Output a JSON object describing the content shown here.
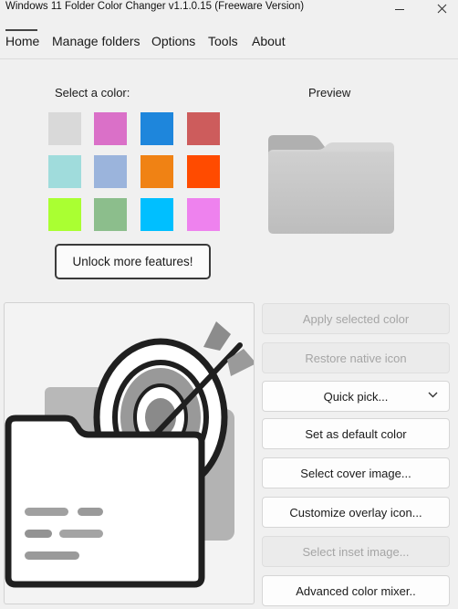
{
  "window": {
    "title": "Windows 11 Folder Color Changer v1.1.0.15 (Freeware Version)",
    "controls": [
      "minimize-icon",
      "close-icon"
    ]
  },
  "menu": {
    "items": [
      {
        "label": "Home",
        "active": true
      },
      {
        "label": "Manage folders"
      },
      {
        "label": "Options"
      },
      {
        "label": "Tools"
      },
      {
        "label": "About"
      }
    ]
  },
  "color_picker": {
    "label": "Select a color:",
    "colors": [
      "#d9d9d9",
      "#da70c8",
      "#1e86dc",
      "#cd5c5c",
      "#a0dcdc",
      "#9bb4dc",
      "#f08214",
      "#ff4b00",
      "#aaff32",
      "#8cbe8c",
      "#00bfff",
      "#ee82ee"
    ],
    "unlock_label": "Unlock more features!"
  },
  "preview": {
    "label": "Preview",
    "folder_color": "#c8c8c8"
  },
  "actions": [
    {
      "label": "Apply selected color",
      "enabled": false
    },
    {
      "label": "Restore native icon",
      "enabled": false
    },
    {
      "label": "Quick pick...",
      "enabled": true,
      "dropdown": true
    },
    {
      "label": "Set as default color",
      "enabled": true
    },
    {
      "label": "Select cover image...",
      "enabled": true
    },
    {
      "label": "Customize overlay icon...",
      "enabled": true
    },
    {
      "label": "Select inset image...",
      "enabled": false
    },
    {
      "label": "Advanced color mixer..",
      "enabled": true
    }
  ]
}
